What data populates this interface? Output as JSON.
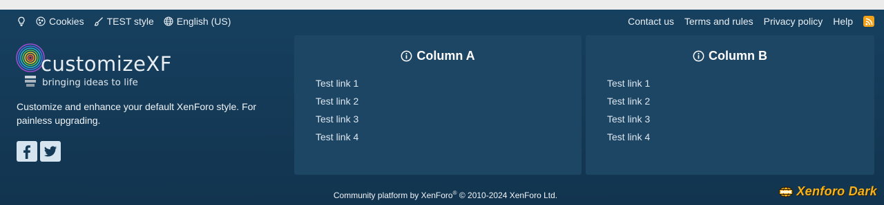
{
  "topbar": {
    "left": [
      {
        "icon": "lightbulb-icon"
      },
      {
        "icon": "cookie-icon",
        "label": "Cookies"
      },
      {
        "icon": "paintbrush-icon",
        "label": "TEST style"
      },
      {
        "icon": "globe-icon",
        "label": "English (US)"
      }
    ],
    "right": [
      "Contact us",
      "Terms and rules",
      "Privacy policy",
      "Help"
    ],
    "rss_icon": "rss-icon"
  },
  "logo": {
    "word": "customizeXF",
    "tagline": "bringing ideas to life"
  },
  "description": "Customize and enhance your default XenForo style. For painless upgrading.",
  "social": [
    {
      "icon": "facebook-icon"
    },
    {
      "icon": "twitter-icon"
    }
  ],
  "columns": [
    {
      "title": "Column A",
      "icon": "info-circle-icon",
      "links": [
        "Test link 1",
        "Test link 2",
        "Test link 3",
        "Test link 4"
      ]
    },
    {
      "title": "Column B",
      "icon": "info-circle-icon",
      "links": [
        "Test link 1",
        "Test link 2",
        "Test link 3",
        "Test link 4"
      ]
    }
  ],
  "copyright": {
    "prefix": "Community platform by XenForo",
    "reg": "®",
    "suffix": " © 2010-2024 XenForo Ltd."
  },
  "brand": {
    "text": "Xenforo Dark",
    "icon": "xenforo-globe-icon"
  },
  "colors": {
    "footer_bg": "#143a57",
    "column_bg": "#1d4564",
    "brand": "#f5b21b",
    "rss": "#f0a21a"
  }
}
